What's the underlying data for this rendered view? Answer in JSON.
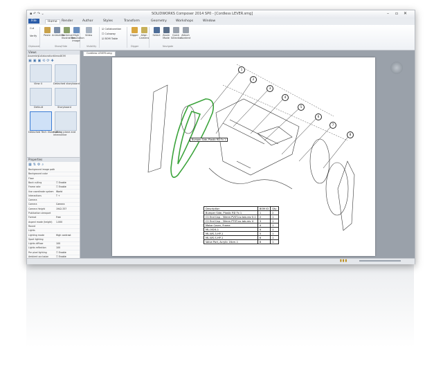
{
  "window": {
    "title": "SOLIDWORKS Composer 2014 SP0 - [Cordless LEVER.smg]",
    "qat": "▪ ↶ ↷ ⌄"
  },
  "tabs": [
    {
      "label": "File",
      "kind": "file"
    },
    {
      "label": "Home",
      "kind": "active"
    },
    {
      "label": "Render",
      "kind": ""
    },
    {
      "label": "Author",
      "kind": ""
    },
    {
      "label": "Styles",
      "kind": ""
    },
    {
      "label": "Transform",
      "kind": ""
    },
    {
      "label": "Geometry",
      "kind": ""
    },
    {
      "label": "Workshops",
      "kind": ""
    },
    {
      "label": "Window",
      "kind": ""
    }
  ],
  "ribbon": {
    "buttons": [
      {
        "label": "Paste",
        "color": "#c9a24a"
      },
      {
        "label": "Animation",
        "color": "#7d8fa8"
      },
      {
        "label": "Technical Illustration",
        "color": "#8aa06a"
      },
      {
        "label": "High Resolution Image",
        "color": "#6a8fbf"
      },
      {
        "label": "Video",
        "color": "#a9b4c2"
      },
      {
        "label": "Digger",
        "color": "#d8a640"
      },
      {
        "label": "Align Camera",
        "color": "#c7b05a"
      },
      {
        "label": "Select",
        "color": "#4f6e99"
      },
      {
        "label": "Zoom Mode",
        "color": "#5a6f8a"
      },
      {
        "label": "Quick Selection",
        "color": "#9aa2ad"
      },
      {
        "label": "Attach Content",
        "color": "#9aa2ad"
      }
    ],
    "checks": [
      "Collaboration",
      "Cutaway",
      "BOM Table"
    ],
    "small": [
      "Cut",
      "Verify"
    ],
    "groups": [
      "Clipboard",
      "Show/Hide",
      "Visibility",
      "Digger",
      "Navigate"
    ]
  },
  "left_panel": {
    "header": "Views",
    "tabs": [
      "Assembly",
      "Collaboration",
      "Views",
      "BOM"
    ],
    "thumbs": [
      {
        "label": "View 4"
      },
      {
        "label": "Detached storyboard"
      },
      {
        "label": "Default"
      },
      {
        "label": "Storyboard"
      },
      {
        "label": "Detached Tech Illustration"
      },
      {
        "label": "Cutting plane and interactive"
      }
    ]
  },
  "properties": {
    "header": "Properties",
    "rows": [
      {
        "k": "Background image path",
        "v": ""
      },
      {
        "k": "Background color",
        "v": ""
      },
      {
        "k": "Floor",
        "v": ""
      },
      {
        "k": "Back culling",
        "v": "☐ Enable"
      },
      {
        "k": "Frame rate",
        "v": "☐ Enable"
      },
      {
        "k": "Use coordinate system",
        "v": "World"
      },
      {
        "k": "Interactions",
        "v": "T +"
      },
      {
        "k": "Camera",
        "v": ""
      },
      {
        "k": "Camera",
        "v": "Camera"
      },
      {
        "k": "Camera Height",
        "v": "1942.337"
      },
      {
        "k": "Publication viewport",
        "v": ""
      },
      {
        "k": "Format",
        "v": "Free"
      },
      {
        "k": "Aspect mode (height)",
        "v": "1.000"
      },
      {
        "k": "Round",
        "v": ""
      },
      {
        "k": "Lights",
        "v": ""
      },
      {
        "k": "Lighting mode",
        "v": "High contrast"
      },
      {
        "k": "Sport lighting",
        "v": ""
      },
      {
        "k": "Lights diffuse",
        "v": "100"
      },
      {
        "k": "Lights reflection",
        "v": "100"
      },
      {
        "k": "Per pixel lighting",
        "v": "☐ Enable"
      },
      {
        "k": "Ambient occlusion",
        "v": "☐ Enable"
      },
      {
        "k": "Glow",
        "v": "☐ Enable"
      }
    ]
  },
  "document": {
    "tab": "Cordless LEVER.smg",
    "tooltip": "Bumper Side, Plastic RD Fx 1",
    "callouts": [
      "1",
      "2",
      "3",
      "4",
      "5",
      "6",
      "7",
      "8"
    ],
    "bom": {
      "headers": [
        "Description",
        "BOM ID",
        "Qty"
      ],
      "rows": [
        [
          "Bumper Side, Plastic RD Fx 1",
          "1",
          "2"
        ],
        [
          "C1 End Cap - 30mm PVST-no tab-rev 0-1",
          "2",
          "1"
        ],
        [
          "C1 End Cap - 30mm PTST-no tab-rev 4",
          "3",
          "1"
        ],
        [
          "Motor Cover, Frame",
          "4",
          "1"
        ],
        [
          "ML-0024-1",
          "4",
          "1"
        ],
        [
          "ML-WS-3-HP-1",
          "5",
          "1"
        ],
        [
          "ML-WS-S-HP-1",
          "6",
          "1"
        ],
        [
          "Valve Port, Acrylic 16cm-1",
          "8",
          "1"
        ]
      ]
    }
  },
  "colors": {
    "file_tab": "#2a5ca8",
    "highlight_part": "#5cc04a",
    "viewport_bg": "#9aa1aa"
  }
}
